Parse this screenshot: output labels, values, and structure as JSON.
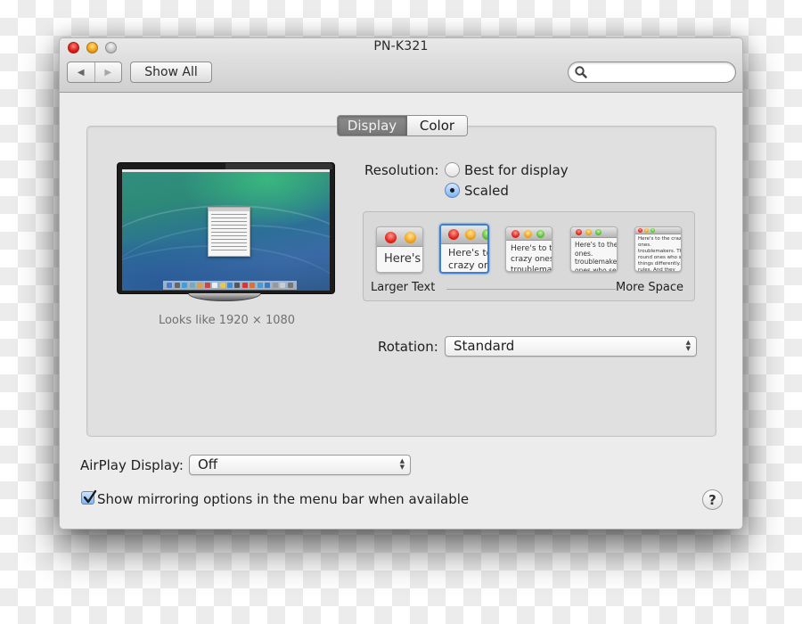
{
  "window": {
    "title": "PN-K321",
    "traffic_lights": [
      "close",
      "minimize",
      "zoom"
    ]
  },
  "toolbar": {
    "back_icon": "◀",
    "forward_icon": "▶",
    "show_all_label": "Show All",
    "search": {
      "value": "",
      "placeholder": ""
    }
  },
  "tabs": [
    {
      "label": "Display",
      "selected": true
    },
    {
      "label": "Color",
      "selected": false
    }
  ],
  "display": {
    "preview_caption": "Looks like 1920 × 1080",
    "resolution": {
      "label": "Resolution:",
      "options": [
        {
          "label": "Best for display",
          "selected": false
        },
        {
          "label": "Scaled",
          "selected": true
        }
      ]
    },
    "scaling": {
      "left_label": "Larger Text",
      "right_label": "More Space",
      "selected_index": 1,
      "thumbnails": [
        {
          "text": "Here's"
        },
        {
          "text": "Here's to the crazy ones. troublemakers."
        },
        {
          "text": "Here's to the crazy ones. troublemakers. ones who see things"
        },
        {
          "text": "Here's to the crazy ones. troublemakers. ones who see things differently. rules. And they have no"
        },
        {
          "text": "Here's to the crazy ones. troublemakers. The round ones who see things differently. rules. And they have no can quote them, disagree them. About the only thing Because they change things."
        }
      ]
    },
    "rotation": {
      "label": "Rotation:",
      "value": "Standard"
    }
  },
  "airplay": {
    "label": "AirPlay Display:",
    "value": "Off"
  },
  "mirroring": {
    "label": "Show mirroring options in the menu bar when available",
    "checked": true
  },
  "help_label": "?",
  "colors": {
    "accent": "#3e7fd6",
    "close": "#e0201a",
    "minimize": "#f0a21a",
    "zoom_disabled": "#c4c4c4"
  }
}
